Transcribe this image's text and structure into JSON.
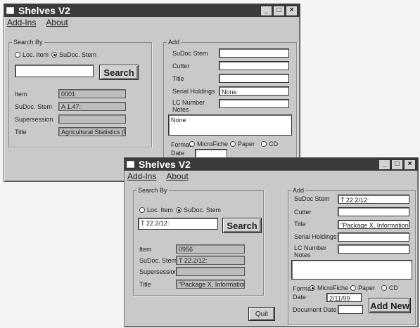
{
  "back_window": {
    "title": "Shelves V2",
    "menu": [
      "Add-Ins",
      "About"
    ],
    "search_by": {
      "legend": "Search By",
      "options": [
        "Loc. Item",
        "SuDoc. Stem"
      ],
      "query": "",
      "button": "Search"
    },
    "results": {
      "item_label": "Item",
      "item_value": "0001",
      "sudoc_label": "SuDoc. Stem",
      "sudoc_value": "A 1.47:",
      "supersession_label": "Supersession",
      "supersession_value": "",
      "title_label": "Title",
      "title_value": "Agricultural Statistics (P)"
    },
    "add": {
      "legend": "Add",
      "sudoc_label": "SuDoc Stem",
      "sudoc_value": "",
      "cutter_label": "Cutter",
      "cutter_value": "",
      "title_label": "Title",
      "title_value": "",
      "serial_label": "Serial Holdings",
      "serial_value": "None",
      "lc_label": "LC Number",
      "notes_label": "Notes",
      "notes_value": "None",
      "format_label": "Format",
      "formats": [
        "MicroFiche",
        "Paper",
        "CD"
      ],
      "date_label": "Date"
    }
  },
  "front_window": {
    "title": "Shelves V2",
    "menu": [
      "Add-Ins",
      "About"
    ],
    "search_by": {
      "legend": "Search By",
      "options": [
        "Loc. Item",
        "SuDoc. Stem"
      ],
      "query": "T 22.2/12:",
      "button": "Search"
    },
    "results": {
      "item_label": "Item",
      "item_value": "0956",
      "sudoc_label": "SuDoc. Stem",
      "sudoc_value": "T 22.2/12:",
      "supersession_label": "Supersession",
      "supersession_value": "",
      "title_label": "Title",
      "title_value": "\"Package X, Informational"
    },
    "add": {
      "legend": "Add",
      "sudoc_label": "SuDoc Stem",
      "sudoc_value": "T 22.2/12:",
      "cutter_label": "Cutter",
      "cutter_value": "",
      "title_label": "Title",
      "title_value": "\"Package X, Informational",
      "serial_label": "Serial Holdings",
      "serial_value": "",
      "lc_label": "LC Number",
      "notes_label": "Notes",
      "notes_value": "",
      "format_label": "Format",
      "formats": [
        "MicroFiche",
        "Paper",
        "CD"
      ],
      "date_label": "Date",
      "date_value": "2/11/99",
      "document_date_label": "Document Date",
      "document_date_value": "",
      "add_button": "Add New"
    },
    "quit_button": "Quit"
  },
  "colors": {
    "titlebar": "#3a3a3a",
    "window_face": "#c9c9c9"
  },
  "icons": [
    "system-menu-icon",
    "minimize-icon",
    "maximize-icon",
    "close-icon"
  ]
}
